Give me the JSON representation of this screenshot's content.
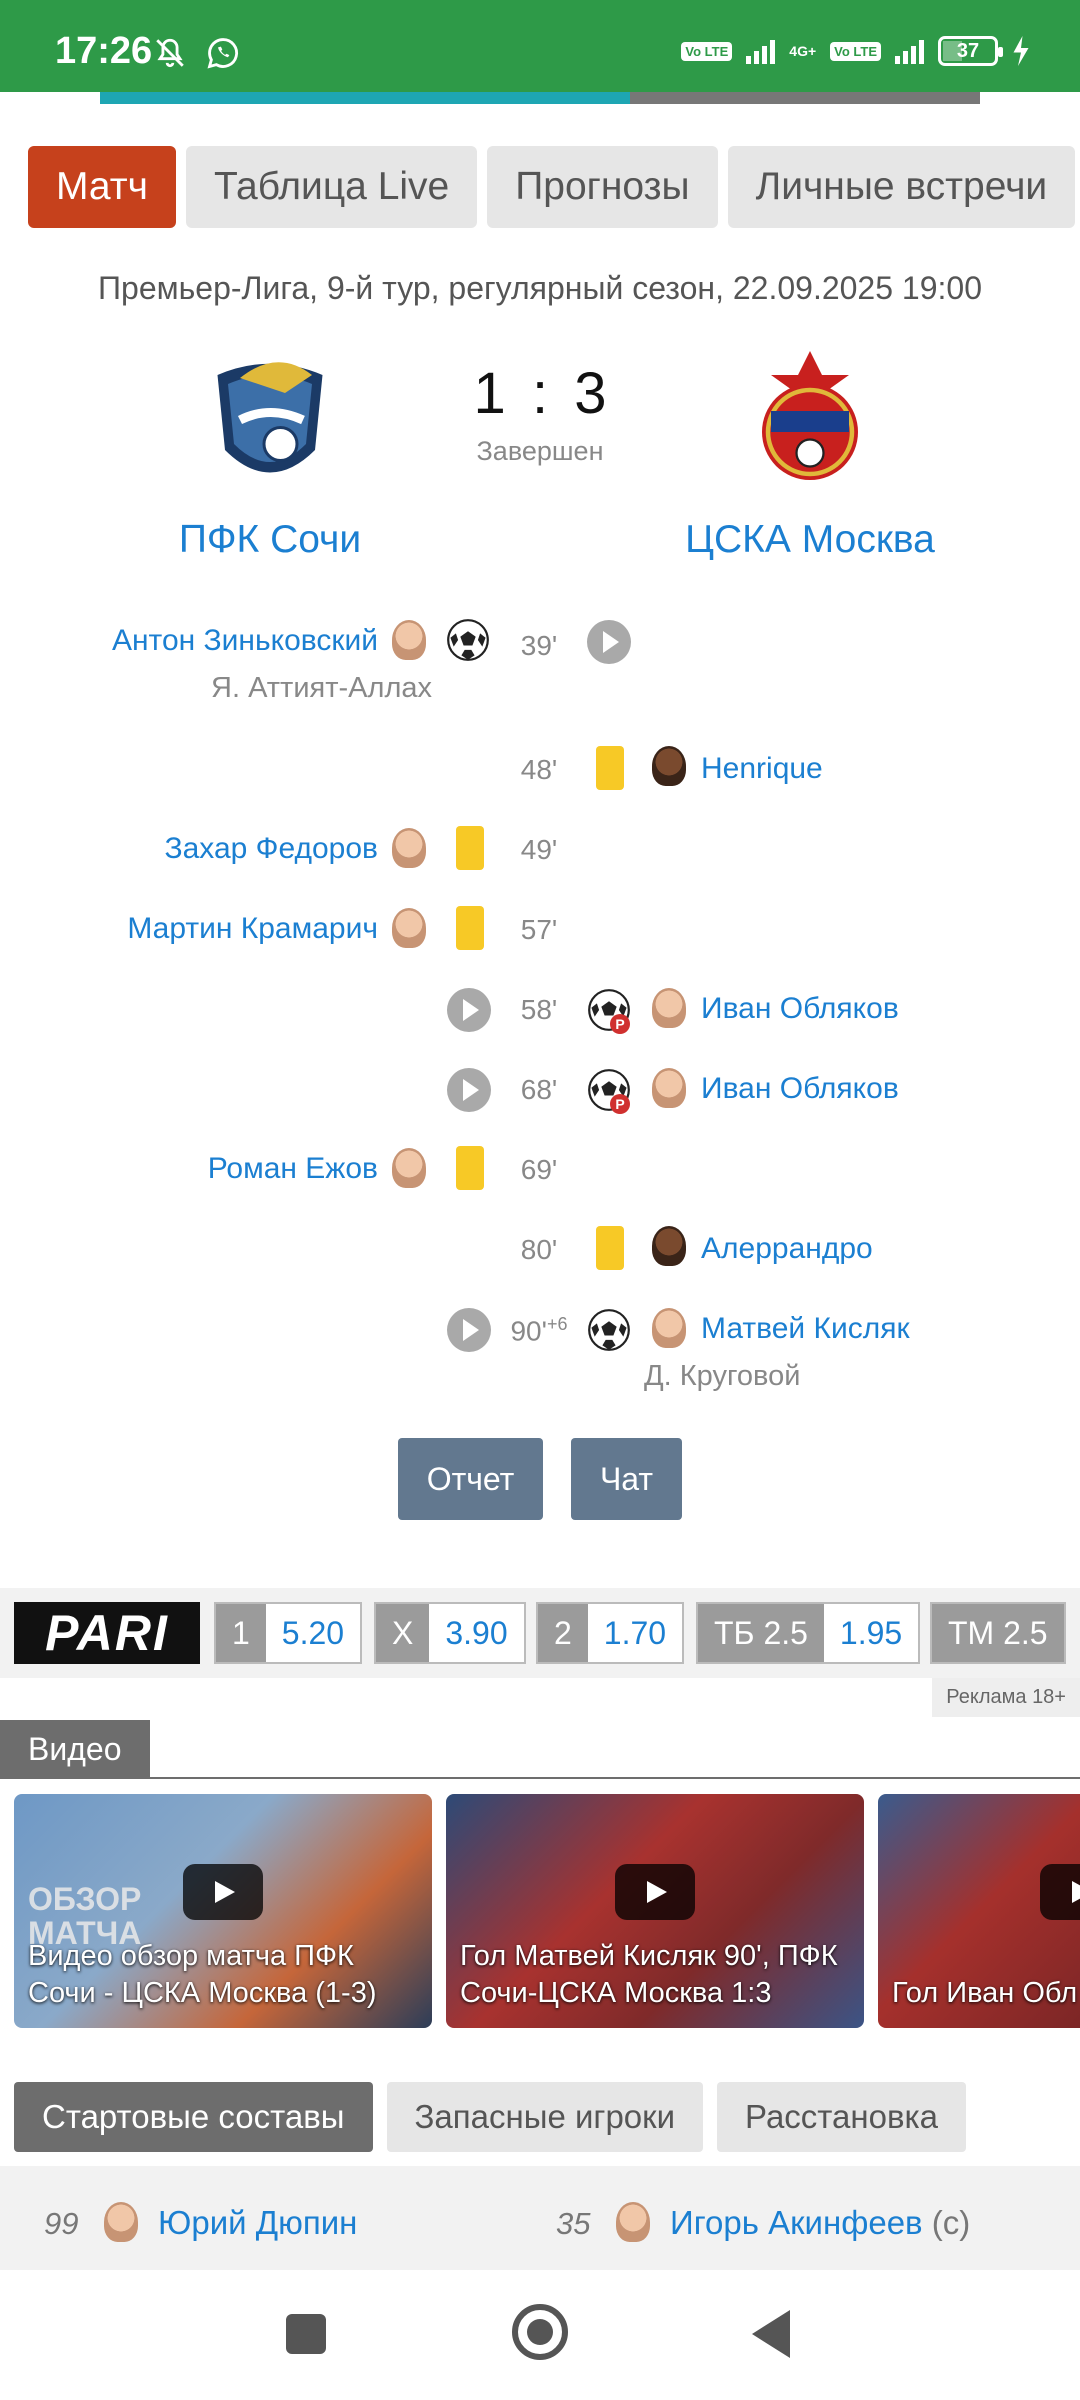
{
  "status_bar": {
    "time": "17:26",
    "battery": "37",
    "network": "4G+",
    "volte": "Vo LTE"
  },
  "tabs": [
    {
      "label": "Матч",
      "active": true
    },
    {
      "label": "Таблица Live",
      "active": false
    },
    {
      "label": "Прогнозы",
      "active": false
    },
    {
      "label": "Личные встречи",
      "active": false
    }
  ],
  "match": {
    "meta": "Премьер-Лига, 9-й тур, регулярный сезон, 22.09.2025 19:00",
    "home_score": "1",
    "away_score": "3",
    "score_sep": ":",
    "status": "Завершен",
    "home_team": "ПФК Сочи",
    "away_team": "ЦСКА Москва"
  },
  "events": [
    {
      "minute": "39'",
      "home_player": "Антон Зиньковский",
      "home_assist": "Я. Аттият-Аллах",
      "type": "goal"
    },
    {
      "minute": "48'",
      "away_player": "Henrique",
      "type": "yellow"
    },
    {
      "minute": "49'",
      "home_player": "Захар Федоров",
      "type": "yellow"
    },
    {
      "minute": "57'",
      "home_player": "Мартин Крамарич",
      "type": "yellow"
    },
    {
      "minute": "58'",
      "away_player": "Иван Обляков",
      "type": "penalty-goal"
    },
    {
      "minute": "68'",
      "away_player": "Иван Обляков",
      "type": "penalty-goal"
    },
    {
      "minute": "69'",
      "home_player": "Роман Ежов",
      "type": "yellow"
    },
    {
      "minute": "80'",
      "away_player": "Алеррандро",
      "type": "yellow"
    },
    {
      "minute": "90'",
      "minute_extra": "+6",
      "away_player": "Матвей Кисляк",
      "away_assist": "Д. Круговой",
      "type": "goal"
    }
  ],
  "penalty_mark": "P",
  "buttons": {
    "report": "Отчет",
    "chat": "Чат"
  },
  "betting": {
    "brand": "PARI",
    "odds": [
      {
        "key": "1",
        "value": "5.20"
      },
      {
        "key": "X",
        "value": "3.90"
      },
      {
        "key": "2",
        "value": "1.70"
      },
      {
        "key": "ТБ 2.5",
        "value": "1.95"
      },
      {
        "key": "ТМ 2.5",
        "value": ""
      }
    ],
    "ad_note": "Реклама 18+"
  },
  "video": {
    "section_label": "Видео",
    "items": [
      {
        "caption": "Видео обзор матча ПФК Сочи - ЦСКА Москва (1-3)",
        "overlay": "ОБЗОР\nМАТЧА"
      },
      {
        "caption": "Гол Матвей Кисляк 90', ПФК Сочи-ЦСКА Москва 1:3",
        "overlay": ""
      },
      {
        "caption": "Гол Иван Обл Сочи-ЦСКА М",
        "overlay": ""
      }
    ]
  },
  "lineup": {
    "tabs": [
      {
        "label": "Стартовые составы",
        "active": true
      },
      {
        "label": "Запасные игроки",
        "active": false
      },
      {
        "label": "Расстановка",
        "active": false
      }
    ],
    "home_number": "99",
    "home_player": "Юрий Дюпин",
    "away_number": "35",
    "away_player": "Игорь Акинфеев",
    "away_captain": "(c)"
  },
  "colors": {
    "status_bar": "#2e9a48",
    "active_tab": "#c6411c",
    "link": "#1b7fd1",
    "button": "#62788f",
    "yellow_card": "#f7c926"
  }
}
